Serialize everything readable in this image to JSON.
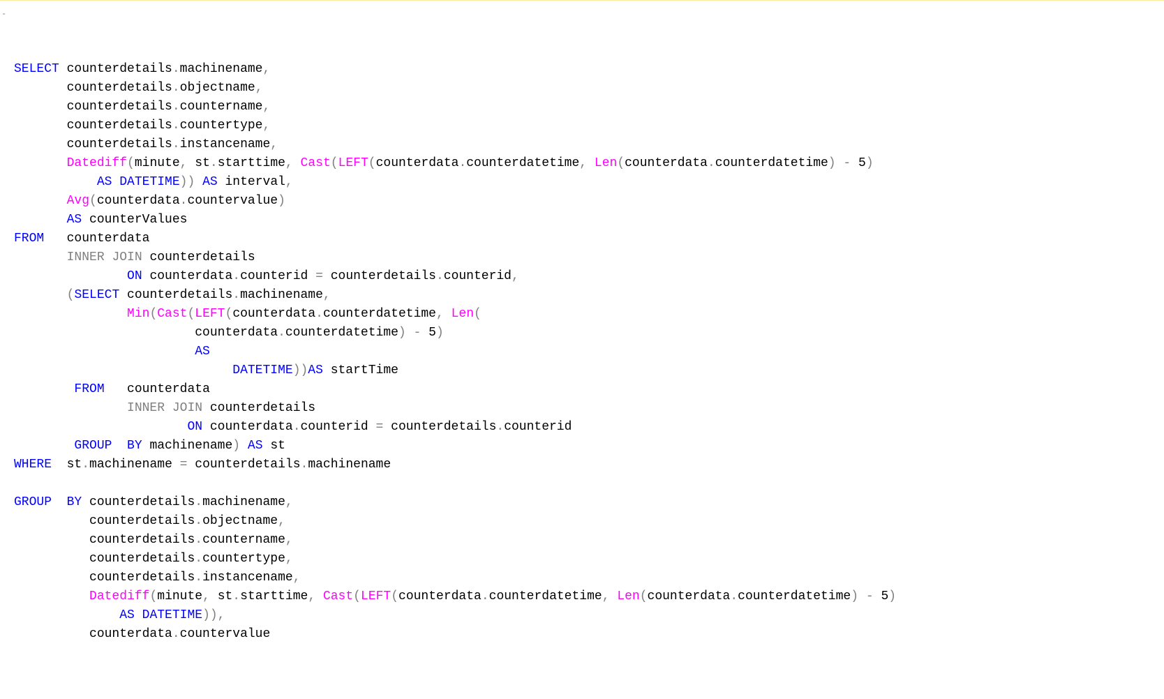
{
  "fold_marker": "-",
  "code": {
    "lines": [
      [
        {
          "cls": "fold",
          "text": ""
        },
        {
          "cls": "kw-blue",
          "text": "SELECT"
        },
        {
          "cls": "ident",
          "text": " counterdetails"
        },
        {
          "cls": "punct",
          "text": "."
        },
        {
          "cls": "ident",
          "text": "machinename"
        },
        {
          "cls": "punct",
          "text": ","
        }
      ],
      [
        {
          "cls": "ident",
          "text": "       counterdetails"
        },
        {
          "cls": "punct",
          "text": "."
        },
        {
          "cls": "ident",
          "text": "objectname"
        },
        {
          "cls": "punct",
          "text": ","
        }
      ],
      [
        {
          "cls": "ident",
          "text": "       counterdetails"
        },
        {
          "cls": "punct",
          "text": "."
        },
        {
          "cls": "ident",
          "text": "countername"
        },
        {
          "cls": "punct",
          "text": ","
        }
      ],
      [
        {
          "cls": "ident",
          "text": "       counterdetails"
        },
        {
          "cls": "punct",
          "text": "."
        },
        {
          "cls": "ident",
          "text": "countertype"
        },
        {
          "cls": "punct",
          "text": ","
        }
      ],
      [
        {
          "cls": "ident",
          "text": "       counterdetails"
        },
        {
          "cls": "punct",
          "text": "."
        },
        {
          "cls": "ident",
          "text": "instancename"
        },
        {
          "cls": "punct",
          "text": ","
        }
      ],
      [
        {
          "cls": "ident",
          "text": "       "
        },
        {
          "cls": "kw-pink",
          "text": "Datediff"
        },
        {
          "cls": "punct",
          "text": "("
        },
        {
          "cls": "ident",
          "text": "minute"
        },
        {
          "cls": "punct",
          "text": ","
        },
        {
          "cls": "ident",
          "text": " st"
        },
        {
          "cls": "punct",
          "text": "."
        },
        {
          "cls": "ident",
          "text": "starttime"
        },
        {
          "cls": "punct",
          "text": ","
        },
        {
          "cls": "ident",
          "text": " "
        },
        {
          "cls": "kw-pink",
          "text": "Cast"
        },
        {
          "cls": "punct",
          "text": "("
        },
        {
          "cls": "kw-pink",
          "text": "LEFT"
        },
        {
          "cls": "punct",
          "text": "("
        },
        {
          "cls": "ident",
          "text": "counterdata"
        },
        {
          "cls": "punct",
          "text": "."
        },
        {
          "cls": "ident",
          "text": "counterdatetime"
        },
        {
          "cls": "punct",
          "text": ","
        },
        {
          "cls": "ident",
          "text": " "
        },
        {
          "cls": "kw-pink",
          "text": "Len"
        },
        {
          "cls": "punct",
          "text": "("
        },
        {
          "cls": "ident",
          "text": "counterdata"
        },
        {
          "cls": "punct",
          "text": "."
        },
        {
          "cls": "ident",
          "text": "counterdatetime"
        },
        {
          "cls": "punct",
          "text": ")"
        },
        {
          "cls": "ident",
          "text": " "
        },
        {
          "cls": "punct",
          "text": "-"
        },
        {
          "cls": "ident",
          "text": " 5"
        },
        {
          "cls": "punct",
          "text": ")"
        }
      ],
      [
        {
          "cls": "ident",
          "text": "           "
        },
        {
          "cls": "kw-blue",
          "text": "AS"
        },
        {
          "cls": "ident",
          "text": " "
        },
        {
          "cls": "kw-blue",
          "text": "DATETIME"
        },
        {
          "cls": "punct",
          "text": "))"
        },
        {
          "cls": "ident",
          "text": " "
        },
        {
          "cls": "kw-blue",
          "text": "AS"
        },
        {
          "cls": "ident",
          "text": " interval"
        },
        {
          "cls": "punct",
          "text": ","
        }
      ],
      [
        {
          "cls": "ident",
          "text": "       "
        },
        {
          "cls": "kw-pink",
          "text": "Avg"
        },
        {
          "cls": "punct",
          "text": "("
        },
        {
          "cls": "ident",
          "text": "counterdata"
        },
        {
          "cls": "punct",
          "text": "."
        },
        {
          "cls": "ident",
          "text": "countervalue"
        },
        {
          "cls": "punct",
          "text": ")"
        }
      ],
      [
        {
          "cls": "ident",
          "text": "       "
        },
        {
          "cls": "kw-blue",
          "text": "AS"
        },
        {
          "cls": "ident",
          "text": " counterValues"
        }
      ],
      [
        {
          "cls": "kw-blue",
          "text": "FROM"
        },
        {
          "cls": "ident",
          "text": "   counterdata"
        }
      ],
      [
        {
          "cls": "ident",
          "text": "       "
        },
        {
          "cls": "kw-gray",
          "text": "INNER"
        },
        {
          "cls": "ident",
          "text": " "
        },
        {
          "cls": "kw-gray",
          "text": "JOIN"
        },
        {
          "cls": "ident",
          "text": " counterdetails"
        }
      ],
      [
        {
          "cls": "ident",
          "text": "               "
        },
        {
          "cls": "kw-blue",
          "text": "ON"
        },
        {
          "cls": "ident",
          "text": " counterdata"
        },
        {
          "cls": "punct",
          "text": "."
        },
        {
          "cls": "ident",
          "text": "counterid "
        },
        {
          "cls": "punct",
          "text": "="
        },
        {
          "cls": "ident",
          "text": " counterdetails"
        },
        {
          "cls": "punct",
          "text": "."
        },
        {
          "cls": "ident",
          "text": "counterid"
        },
        {
          "cls": "punct",
          "text": ","
        }
      ],
      [
        {
          "cls": "ident",
          "text": "       "
        },
        {
          "cls": "punct",
          "text": "("
        },
        {
          "cls": "kw-blue",
          "text": "SELECT"
        },
        {
          "cls": "ident",
          "text": " counterdetails"
        },
        {
          "cls": "punct",
          "text": "."
        },
        {
          "cls": "ident",
          "text": "machinename"
        },
        {
          "cls": "punct",
          "text": ","
        }
      ],
      [
        {
          "cls": "ident",
          "text": "               "
        },
        {
          "cls": "kw-pink",
          "text": "Min"
        },
        {
          "cls": "punct",
          "text": "("
        },
        {
          "cls": "kw-pink",
          "text": "Cast"
        },
        {
          "cls": "punct",
          "text": "("
        },
        {
          "cls": "kw-pink",
          "text": "LEFT"
        },
        {
          "cls": "punct",
          "text": "("
        },
        {
          "cls": "ident",
          "text": "counterdata"
        },
        {
          "cls": "punct",
          "text": "."
        },
        {
          "cls": "ident",
          "text": "counterdatetime"
        },
        {
          "cls": "punct",
          "text": ","
        },
        {
          "cls": "ident",
          "text": " "
        },
        {
          "cls": "kw-pink",
          "text": "Len"
        },
        {
          "cls": "punct",
          "text": "("
        }
      ],
      [
        {
          "cls": "ident",
          "text": "                        counterdata"
        },
        {
          "cls": "punct",
          "text": "."
        },
        {
          "cls": "ident",
          "text": "counterdatetime"
        },
        {
          "cls": "punct",
          "text": ")"
        },
        {
          "cls": "ident",
          "text": " "
        },
        {
          "cls": "punct",
          "text": "-"
        },
        {
          "cls": "ident",
          "text": " 5"
        },
        {
          "cls": "punct",
          "text": ")"
        }
      ],
      [
        {
          "cls": "ident",
          "text": "                        "
        },
        {
          "cls": "kw-blue",
          "text": "AS"
        }
      ],
      [
        {
          "cls": "ident",
          "text": "                             "
        },
        {
          "cls": "kw-blue",
          "text": "DATETIME"
        },
        {
          "cls": "punct",
          "text": "))"
        },
        {
          "cls": "kw-blue",
          "text": "AS"
        },
        {
          "cls": "ident",
          "text": " startTime"
        }
      ],
      [
        {
          "cls": "ident",
          "text": "        "
        },
        {
          "cls": "kw-blue",
          "text": "FROM"
        },
        {
          "cls": "ident",
          "text": "   counterdata"
        }
      ],
      [
        {
          "cls": "ident",
          "text": "               "
        },
        {
          "cls": "kw-gray",
          "text": "INNER"
        },
        {
          "cls": "ident",
          "text": " "
        },
        {
          "cls": "kw-gray",
          "text": "JOIN"
        },
        {
          "cls": "ident",
          "text": " counterdetails"
        }
      ],
      [
        {
          "cls": "ident",
          "text": "                       "
        },
        {
          "cls": "kw-blue",
          "text": "ON"
        },
        {
          "cls": "ident",
          "text": " counterdata"
        },
        {
          "cls": "punct",
          "text": "."
        },
        {
          "cls": "ident",
          "text": "counterid "
        },
        {
          "cls": "punct",
          "text": "="
        },
        {
          "cls": "ident",
          "text": " counterdetails"
        },
        {
          "cls": "punct",
          "text": "."
        },
        {
          "cls": "ident",
          "text": "counterid"
        }
      ],
      [
        {
          "cls": "ident",
          "text": "        "
        },
        {
          "cls": "kw-blue",
          "text": "GROUP"
        },
        {
          "cls": "ident",
          "text": "  "
        },
        {
          "cls": "kw-blue",
          "text": "BY"
        },
        {
          "cls": "ident",
          "text": " machinename"
        },
        {
          "cls": "punct",
          "text": ")"
        },
        {
          "cls": "ident",
          "text": " "
        },
        {
          "cls": "kw-blue",
          "text": "AS"
        },
        {
          "cls": "ident",
          "text": " st"
        }
      ],
      [
        {
          "cls": "kw-blue",
          "text": "WHERE"
        },
        {
          "cls": "ident",
          "text": "  st"
        },
        {
          "cls": "punct",
          "text": "."
        },
        {
          "cls": "ident",
          "text": "machinename "
        },
        {
          "cls": "punct",
          "text": "="
        },
        {
          "cls": "ident",
          "text": " counterdetails"
        },
        {
          "cls": "punct",
          "text": "."
        },
        {
          "cls": "ident",
          "text": "machinename"
        }
      ],
      [
        {
          "cls": "ident",
          "text": " "
        }
      ],
      [
        {
          "cls": "kw-blue",
          "text": "GROUP"
        },
        {
          "cls": "ident",
          "text": "  "
        },
        {
          "cls": "kw-blue",
          "text": "BY"
        },
        {
          "cls": "ident",
          "text": " counterdetails"
        },
        {
          "cls": "punct",
          "text": "."
        },
        {
          "cls": "ident",
          "text": "machinename"
        },
        {
          "cls": "punct",
          "text": ","
        }
      ],
      [
        {
          "cls": "ident",
          "text": "          counterdetails"
        },
        {
          "cls": "punct",
          "text": "."
        },
        {
          "cls": "ident",
          "text": "objectname"
        },
        {
          "cls": "punct",
          "text": ","
        }
      ],
      [
        {
          "cls": "ident",
          "text": "          counterdetails"
        },
        {
          "cls": "punct",
          "text": "."
        },
        {
          "cls": "ident",
          "text": "countername"
        },
        {
          "cls": "punct",
          "text": ","
        }
      ],
      [
        {
          "cls": "ident",
          "text": "          counterdetails"
        },
        {
          "cls": "punct",
          "text": "."
        },
        {
          "cls": "ident",
          "text": "countertype"
        },
        {
          "cls": "punct",
          "text": ","
        }
      ],
      [
        {
          "cls": "ident",
          "text": "          counterdetails"
        },
        {
          "cls": "punct",
          "text": "."
        },
        {
          "cls": "ident",
          "text": "instancename"
        },
        {
          "cls": "punct",
          "text": ","
        }
      ],
      [
        {
          "cls": "ident",
          "text": "          "
        },
        {
          "cls": "kw-pink",
          "text": "Datediff"
        },
        {
          "cls": "punct",
          "text": "("
        },
        {
          "cls": "ident",
          "text": "minute"
        },
        {
          "cls": "punct",
          "text": ","
        },
        {
          "cls": "ident",
          "text": " st"
        },
        {
          "cls": "punct",
          "text": "."
        },
        {
          "cls": "ident",
          "text": "starttime"
        },
        {
          "cls": "punct",
          "text": ","
        },
        {
          "cls": "ident",
          "text": " "
        },
        {
          "cls": "kw-pink",
          "text": "Cast"
        },
        {
          "cls": "punct",
          "text": "("
        },
        {
          "cls": "kw-pink",
          "text": "LEFT"
        },
        {
          "cls": "punct",
          "text": "("
        },
        {
          "cls": "ident",
          "text": "counterdata"
        },
        {
          "cls": "punct",
          "text": "."
        },
        {
          "cls": "ident",
          "text": "counterdatetime"
        },
        {
          "cls": "punct",
          "text": ","
        },
        {
          "cls": "ident",
          "text": " "
        },
        {
          "cls": "kw-pink",
          "text": "Len"
        },
        {
          "cls": "punct",
          "text": "("
        },
        {
          "cls": "ident",
          "text": "counterdata"
        },
        {
          "cls": "punct",
          "text": "."
        },
        {
          "cls": "ident",
          "text": "counterdatetime"
        },
        {
          "cls": "punct",
          "text": ")"
        },
        {
          "cls": "ident",
          "text": " "
        },
        {
          "cls": "punct",
          "text": "-"
        },
        {
          "cls": "ident",
          "text": " 5"
        },
        {
          "cls": "punct",
          "text": ")"
        }
      ],
      [
        {
          "cls": "ident",
          "text": "              "
        },
        {
          "cls": "kw-blue",
          "text": "AS"
        },
        {
          "cls": "ident",
          "text": " "
        },
        {
          "cls": "kw-blue",
          "text": "DATETIME"
        },
        {
          "cls": "punct",
          "text": ")),"
        }
      ],
      [
        {
          "cls": "ident",
          "text": "          counterdata"
        },
        {
          "cls": "punct",
          "text": "."
        },
        {
          "cls": "ident",
          "text": "countervalue"
        }
      ]
    ]
  }
}
